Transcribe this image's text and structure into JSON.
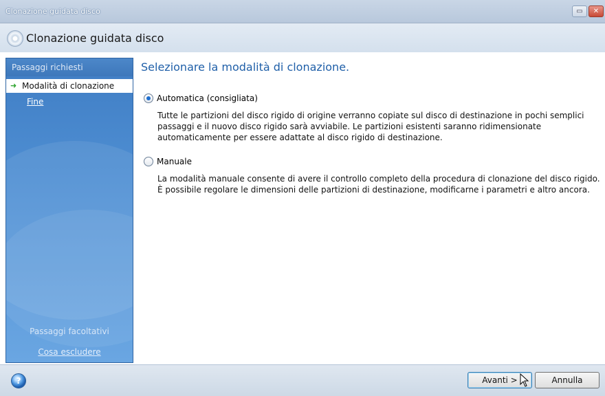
{
  "window": {
    "title": "Clonazione guidata disco",
    "header_title": "Clonazione guidata disco"
  },
  "sidebar": {
    "required_heading": "Passaggi richiesti",
    "steps": [
      {
        "label": "Modalità di clonazione",
        "active": true
      },
      {
        "label": "Fine",
        "active": false
      }
    ],
    "optional_heading": "Passaggi facoltativi",
    "optional_steps": [
      {
        "label": "Cosa escludere"
      }
    ]
  },
  "main": {
    "title": "Selezionare la modalità di clonazione.",
    "options": [
      {
        "label": "Automatica (consigliata)",
        "checked": true,
        "description": "Tutte le partizioni del disco rigido di origine verranno copiate sul disco di destinazione in pochi semplici passaggi e il nuovo disco rigido sarà avviabile. Le partizioni esistenti saranno ridimensionate automaticamente per essere adattate al disco rigido di destinazione."
      },
      {
        "label": "Manuale",
        "checked": false,
        "description": "La modalità manuale consente di avere il controllo completo della procedura di clonazione del disco rigido. È possibile regolare le dimensioni delle partizioni di destinazione, modificarne i parametri e altro ancora."
      }
    ]
  },
  "footer": {
    "next_label": "Avanti >",
    "cancel_label": "Annulla"
  },
  "icons": {
    "help": "help-icon",
    "step_arrow": "arrow-right-icon",
    "disc": "disc-icon"
  }
}
